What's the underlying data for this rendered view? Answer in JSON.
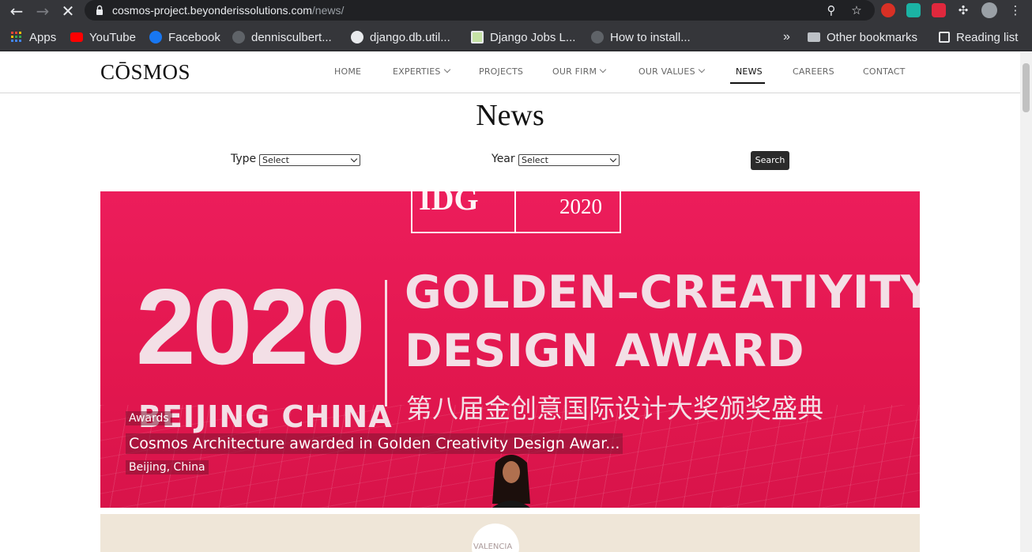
{
  "browser": {
    "url_domain": "cosmos-project.beyonderissolutions.com",
    "url_path": "/news/",
    "bookmarks": [
      {
        "label": "Apps",
        "icon": "apps-grid-icon"
      },
      {
        "label": "YouTube",
        "icon": "youtube-icon"
      },
      {
        "label": "Facebook",
        "icon": "facebook-icon"
      },
      {
        "label": "dennisculbert...",
        "icon": "github-icon"
      },
      {
        "label": "django.db.util...",
        "icon": "globe-icon"
      },
      {
        "label": "Django Jobs L...",
        "icon": "document-icon"
      },
      {
        "label": "How to install...",
        "icon": "github-icon"
      }
    ],
    "overflow": "»",
    "other_bookmarks": "Other bookmarks",
    "reading_list": "Reading list"
  },
  "site": {
    "logo": "CŌSMOS",
    "menu": [
      {
        "label": "HOME",
        "dropdown": false
      },
      {
        "label": "EXPERTIES",
        "dropdown": true
      },
      {
        "label": "PROJECTS",
        "dropdown": false
      },
      {
        "label": "OUR FIRM",
        "dropdown": true
      },
      {
        "label": "OUR VALUES",
        "dropdown": true
      },
      {
        "label": "NEWS",
        "dropdown": false,
        "active": true
      },
      {
        "label": "CAREERS",
        "dropdown": false
      },
      {
        "label": "CONTACT",
        "dropdown": false
      }
    ]
  },
  "page": {
    "title": "News",
    "filters": {
      "type_label": "Type",
      "type_value": "Select",
      "year_label": "Year",
      "year_value": "Select",
      "search_label": "Search"
    }
  },
  "featured": {
    "image_text": {
      "year_big": "2020",
      "sign_year": "2020",
      "sign_left": "IDG",
      "line1": "GOLDEN–CREATIYITY",
      "line2": "DESIGN AWARD",
      "city": "BEIJING CHINA",
      "chinese": "第八届金创意国际设计大奖颁奖盛典"
    },
    "category": "Awards",
    "headline": "Cosmos Architecture awarded in Golden Creativity Design Awar...",
    "location": "Beijing, China"
  },
  "next_card": {
    "text": "VALENCIA"
  },
  "colors": {
    "chrome_bg": "#35363a",
    "omnibox_bg": "#202124",
    "hero_red": "#e3174f",
    "search_btn": "#2b2b2b"
  }
}
